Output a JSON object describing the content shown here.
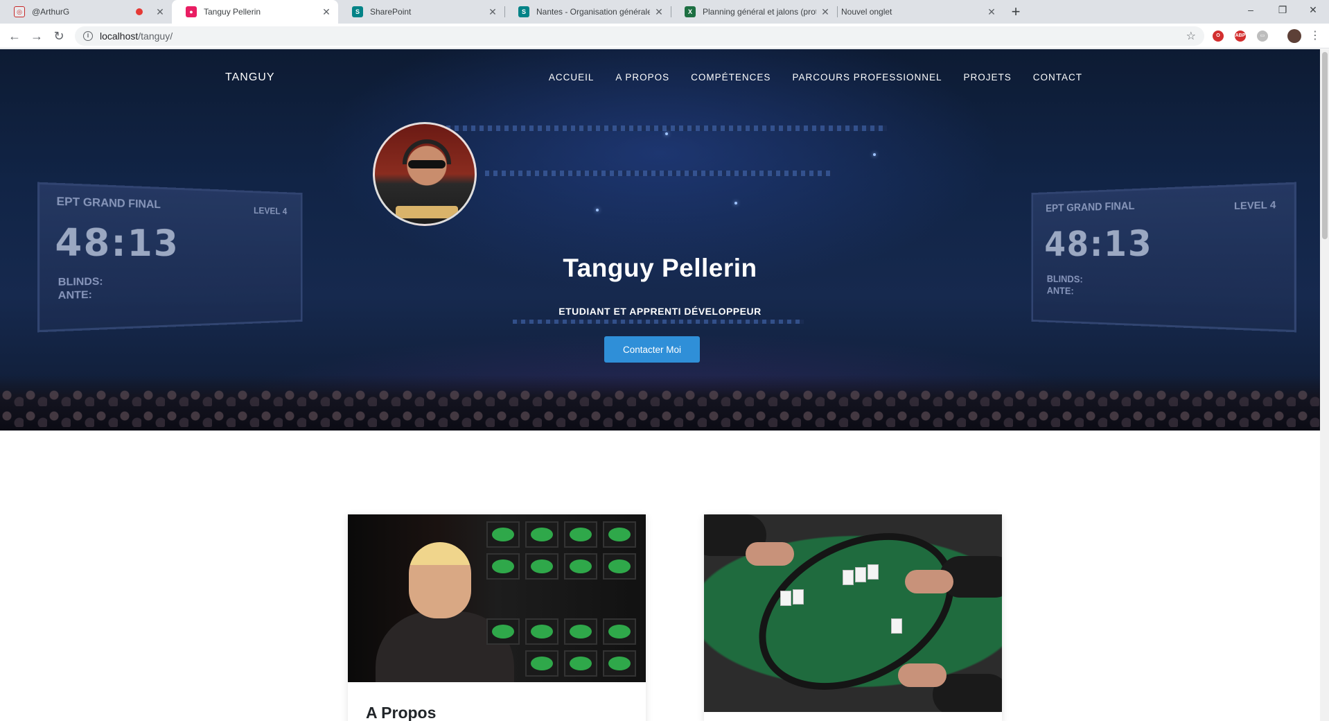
{
  "browser": {
    "tabs": [
      {
        "title": "@ArthurG",
        "recording": true
      },
      {
        "title": "Tanguy Pellerin",
        "active": true
      },
      {
        "title": "SharePoint"
      },
      {
        "title": "Nantes - Organisation générale -"
      },
      {
        "title": "Planning général et jalons (proté"
      },
      {
        "title": "Nouvel onglet"
      }
    ],
    "new_tab_label": "+",
    "window_controls": [
      "–",
      "❐",
      "✕"
    ],
    "address": {
      "host": "localhost",
      "path": "/tanguy/"
    },
    "extensions": [
      "opera-icon",
      "adblock-icon",
      "extension-icon",
      "profile-icon"
    ]
  },
  "site": {
    "brand": "TANGUY",
    "menu": [
      "ACCUEIL",
      "A PROPOS",
      "COMPÉTENCES",
      "PARCOURS PROFESSIONNEL",
      "PROJETS",
      "CONTACT"
    ],
    "hero": {
      "name": "Tanguy Pellerin",
      "subtitle": "ETUDIANT ET APPRENTI DÉVELOPPEUR",
      "cta": "Contacter Moi",
      "screen_left": {
        "time": "48:13",
        "label": "EPT GRAND FINAL",
        "level": "LEVEL 4",
        "blinds": "BLINDS:",
        "ante": "ANTE:"
      },
      "screen_right": {
        "time": "48:13",
        "label": "EPT GRAND FINAL",
        "level": "LEVEL 4",
        "blinds": "BLINDS:",
        "ante": "ANTE:"
      }
    },
    "cards": [
      {
        "title": "A Propos"
      },
      {
        "title": ""
      }
    ]
  },
  "colors": {
    "accent": "#2f8fd8",
    "hero_dark": "#112446"
  }
}
